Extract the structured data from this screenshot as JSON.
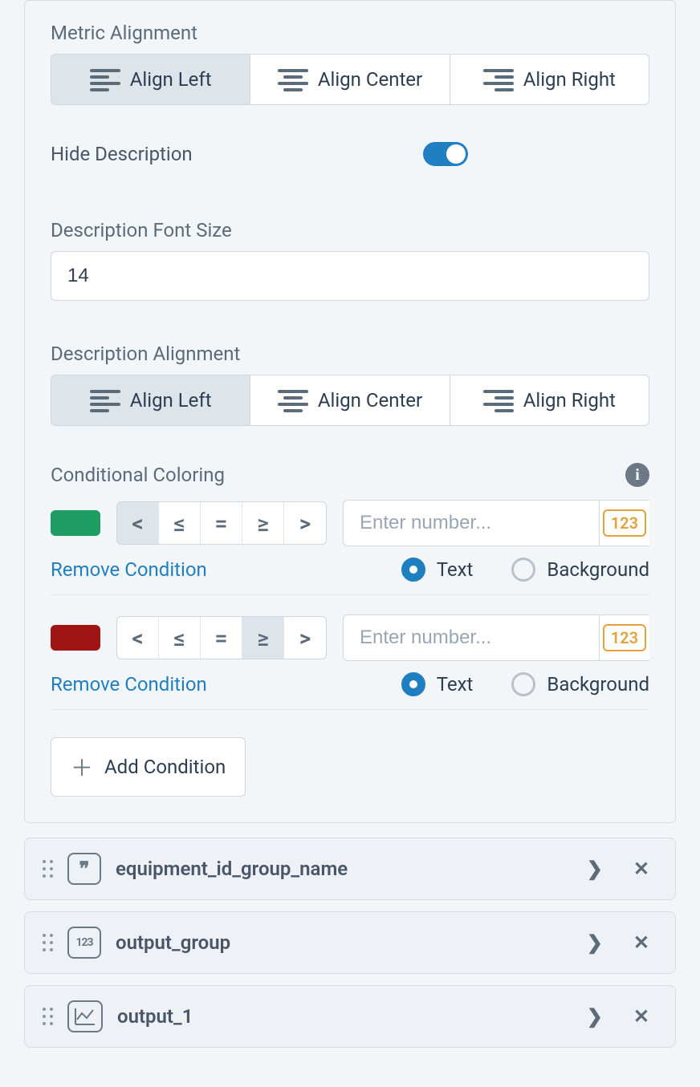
{
  "metricAlignment": {
    "label": "Metric Alignment",
    "options": {
      "left": "Align Left",
      "center": "Align Center",
      "right": "Align Right"
    },
    "selected": "left"
  },
  "hideDescription": {
    "label": "Hide Description",
    "enabled": true
  },
  "descriptionFontSize": {
    "label": "Description Font Size",
    "value": "14"
  },
  "descriptionAlignment": {
    "label": "Description Alignment",
    "options": {
      "left": "Align Left",
      "center": "Align Center",
      "right": "Align Right"
    },
    "selected": "left"
  },
  "conditionalColoring": {
    "label": "Conditional Coloring",
    "operators": {
      "lt": "<",
      "lte": "≤",
      "eq": "=",
      "gte": "≥",
      "gt": ">"
    },
    "numberPlaceholder": "Enter number...",
    "numericBadge": "123",
    "radio": {
      "text": "Text",
      "background": "Background"
    },
    "removeLabel": "Remove Condition",
    "addLabel": "Add Condition",
    "conditions": [
      {
        "color": "#1e9e63",
        "operator": "lt",
        "target": "text"
      },
      {
        "color": "#a01414",
        "operator": "gte",
        "target": "text"
      }
    ]
  },
  "fields": [
    {
      "type": "string",
      "name": "equipment_id_group_name"
    },
    {
      "type": "numeric",
      "name": "output_group"
    },
    {
      "type": "chart",
      "name": "output_1"
    }
  ]
}
